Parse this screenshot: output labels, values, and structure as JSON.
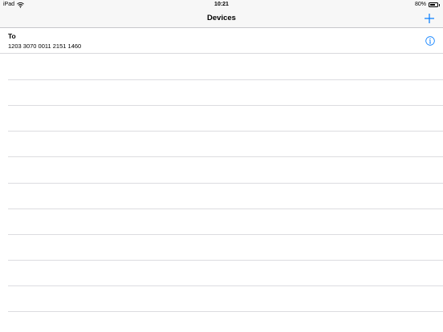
{
  "status_bar": {
    "device": "iPad",
    "time": "10:21",
    "battery": "80%",
    "battery_level": 0.8
  },
  "nav_bar": {
    "title": "Devices",
    "add_icon": "plus-icon"
  },
  "devices": [
    {
      "name": "To",
      "number": "1203 3070 0011 2151 1460",
      "info_icon": "info-icon"
    }
  ],
  "colors": {
    "accent": "#007aff",
    "bar_background": "#f7f7f7",
    "separator": "#c8c7cc"
  }
}
